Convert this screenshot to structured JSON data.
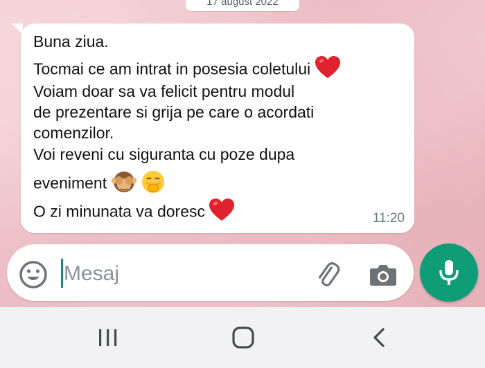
{
  "chat": {
    "date_chip": "17 august 2022",
    "message": {
      "lines": [
        "Buna ziua.",
        "Tocmai ce am intrat in posesia coletului",
        "Voiam doar sa va felicit pentru modul",
        "de prezentare si grija pe care o acordati",
        "comenzilor.",
        "Voi reveni cu siguranta cu poze dupa",
        "eveniment",
        "O zi minunata va doresc"
      ],
      "emojis": {
        "line2": "red-heart",
        "line7": [
          "see-no-evil-monkey",
          "face-with-hand-over-mouth"
        ],
        "line8": "red-heart"
      },
      "time": "11:20"
    }
  },
  "composer": {
    "placeholder": "Mesaj",
    "icons": [
      "emoji-icon",
      "attach-icon",
      "camera-icon",
      "mic-icon"
    ],
    "accent_color": "#0f9d77"
  },
  "navbar": {
    "icons": [
      "recent-apps-icon",
      "home-icon",
      "back-icon"
    ]
  }
}
